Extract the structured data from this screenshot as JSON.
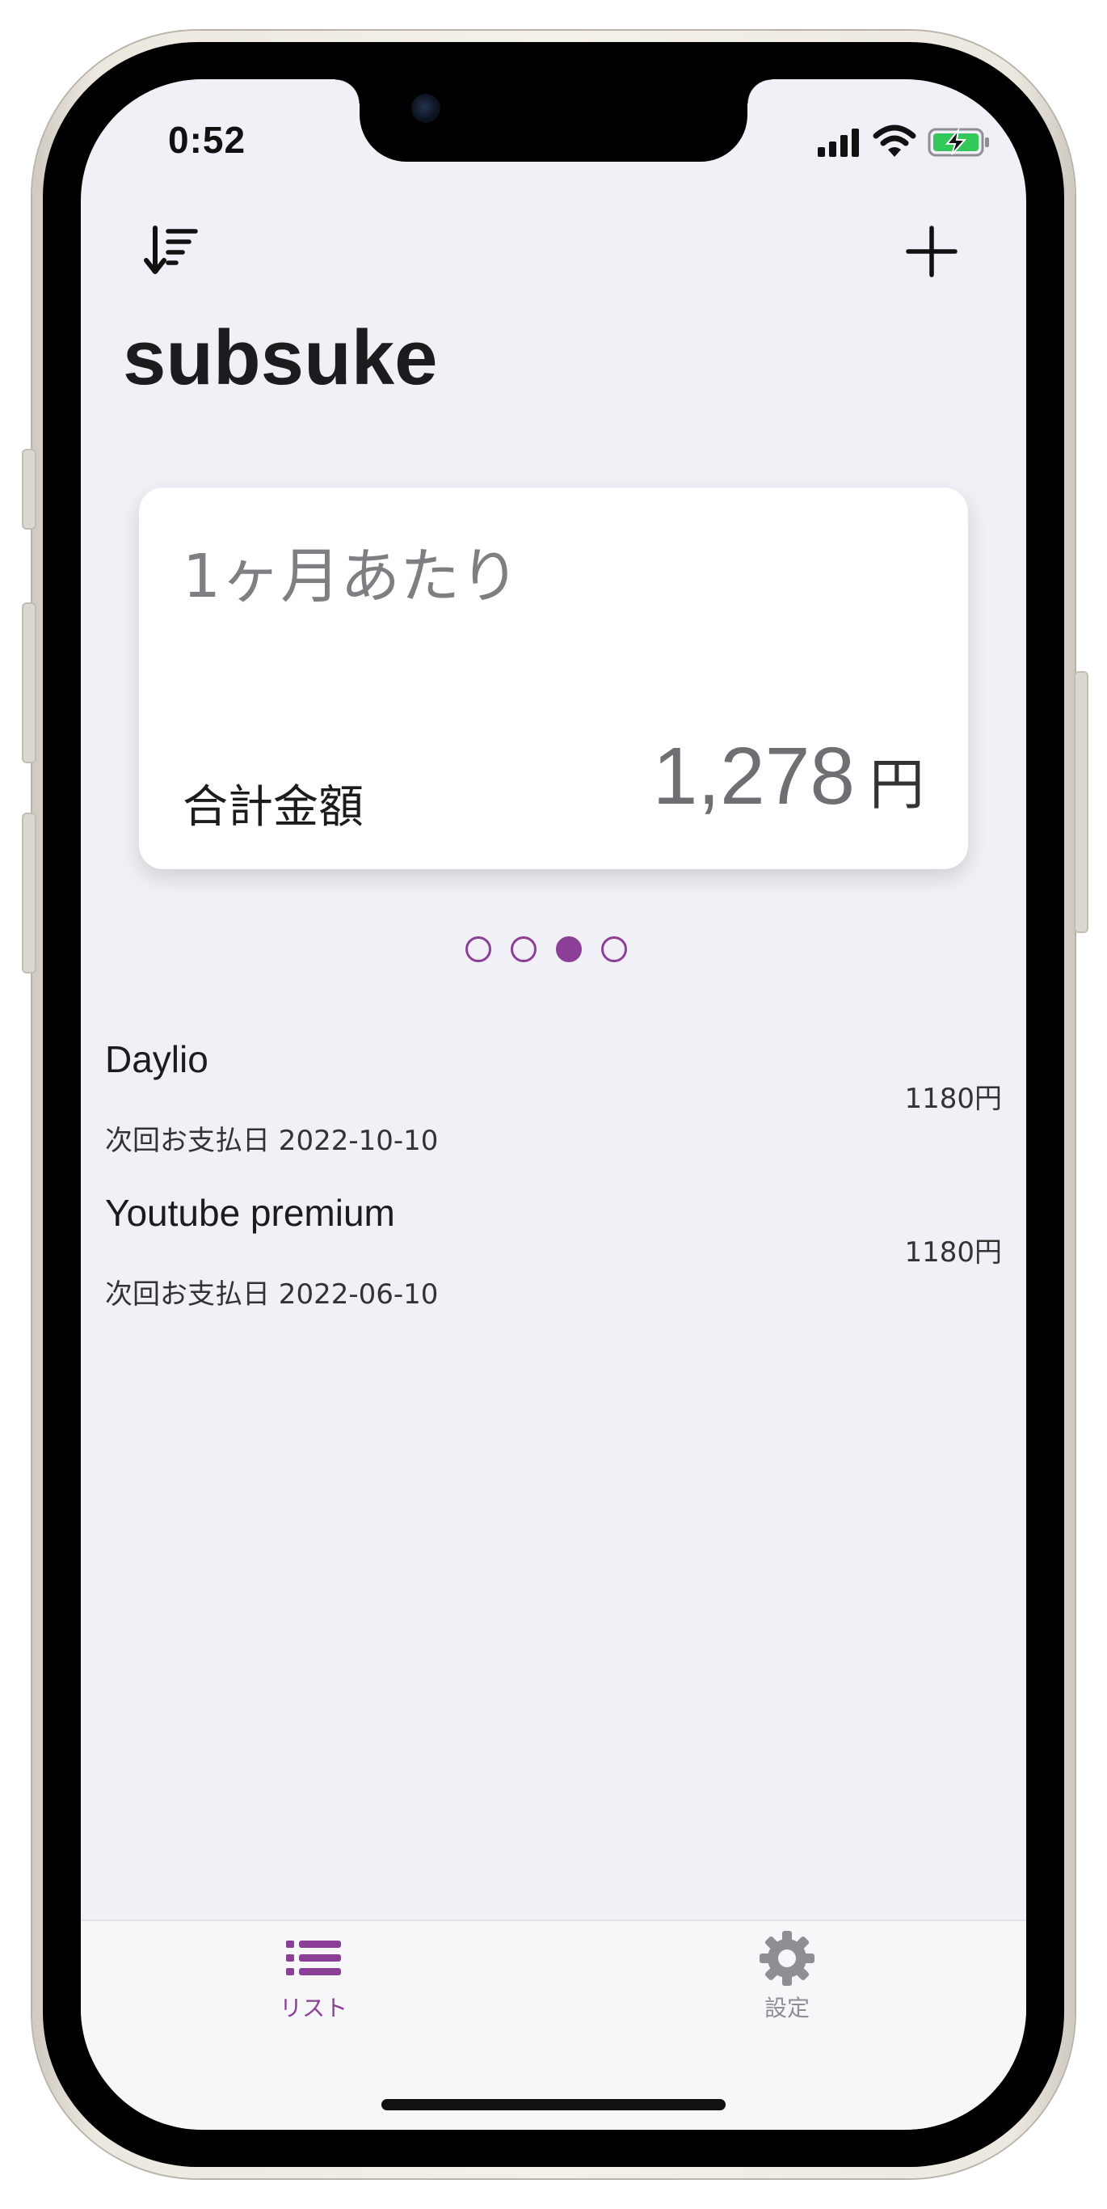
{
  "status_bar": {
    "time": "0:52",
    "signal_icon": "cellular-signal-icon",
    "wifi_icon": "wifi-icon",
    "battery_icon": "battery-charging-icon"
  },
  "nav_bar": {
    "sort_icon": "sort-descending-icon",
    "add_icon": "plus-icon"
  },
  "app_title": "subsuke",
  "summary_card": {
    "period": "1ヶ月あたり",
    "label": "合計金額",
    "amount": "1,278",
    "unit": "円"
  },
  "pager": {
    "page_count": 4,
    "active_index": 2,
    "accent_color": "#8b3f96"
  },
  "subscriptions": [
    {
      "name": "Daylio",
      "next_payment": "次回お支払日 2022-10-10",
      "price": "1180円"
    },
    {
      "name": "Youtube premium",
      "next_payment": "次回お支払日 2022-06-10",
      "price": "1180円"
    }
  ],
  "tab_bar": {
    "tabs": [
      {
        "label": "リスト",
        "icon": "list-icon",
        "active": true
      },
      {
        "label": "設定",
        "icon": "gear-icon",
        "active": false
      }
    ],
    "active_color": "#8b3f96",
    "inactive_color": "#8e8e93"
  }
}
